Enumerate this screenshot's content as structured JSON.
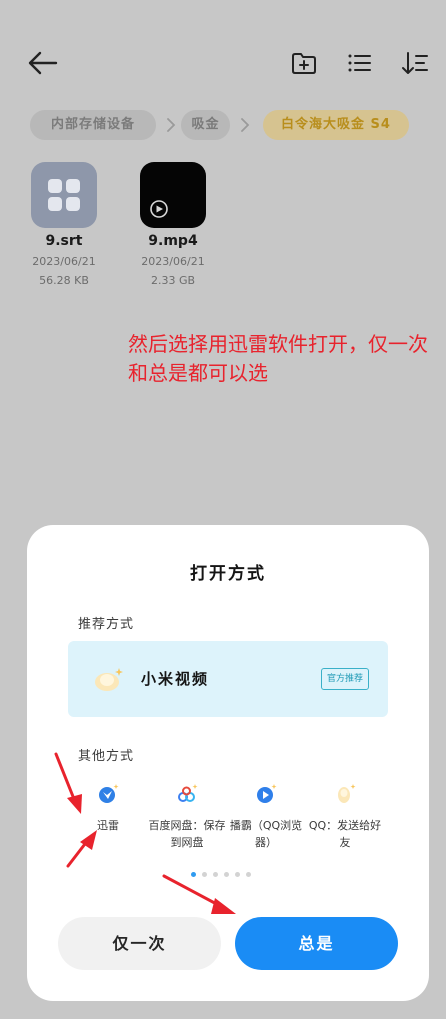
{
  "toolbar": {
    "back_icon": "arrow-left-icon",
    "actions": [
      "new-folder-icon",
      "list-view-icon",
      "sort-icon"
    ]
  },
  "breadcrumb": {
    "items": [
      "内部存储设备",
      "吸金",
      "白令海大吸金 S4"
    ],
    "active_color": "#b88e1c"
  },
  "files": [
    {
      "name": "9.srt",
      "date": "2023/06/21",
      "size": "56.28 KB",
      "icon": "app-grid-icon"
    },
    {
      "name": "9.mp4",
      "date": "2023/06/21",
      "size": "2.33 GB",
      "icon": "video-play-icon"
    }
  ],
  "annotation": {
    "text": "然后选择用迅雷软件打开，仅一次和总是都可以选",
    "color": "#e8232d"
  },
  "dialog": {
    "title": "打开方式",
    "recommended_label": "推荐方式",
    "recommended_app": {
      "name": "小米视频",
      "badge": "官方推荐",
      "icon": "mi-video-icon"
    },
    "other_label": "其他方式",
    "apps": [
      {
        "name": "迅雷",
        "icon": "xunlei-icon"
      },
      {
        "name": "百度网盘：保存到网盘",
        "icon": "baidu-netdisk-icon"
      },
      {
        "name": "播霸（QQ浏览器）",
        "icon": "qq-browser-player-icon"
      },
      {
        "name": "QQ：发送给好友",
        "icon": "qq-icon"
      }
    ],
    "page_indicator": {
      "count": 6,
      "active": 0
    },
    "buttons": {
      "once": "仅一次",
      "always": "总是"
    },
    "primary_color": "#1a8cf5"
  }
}
